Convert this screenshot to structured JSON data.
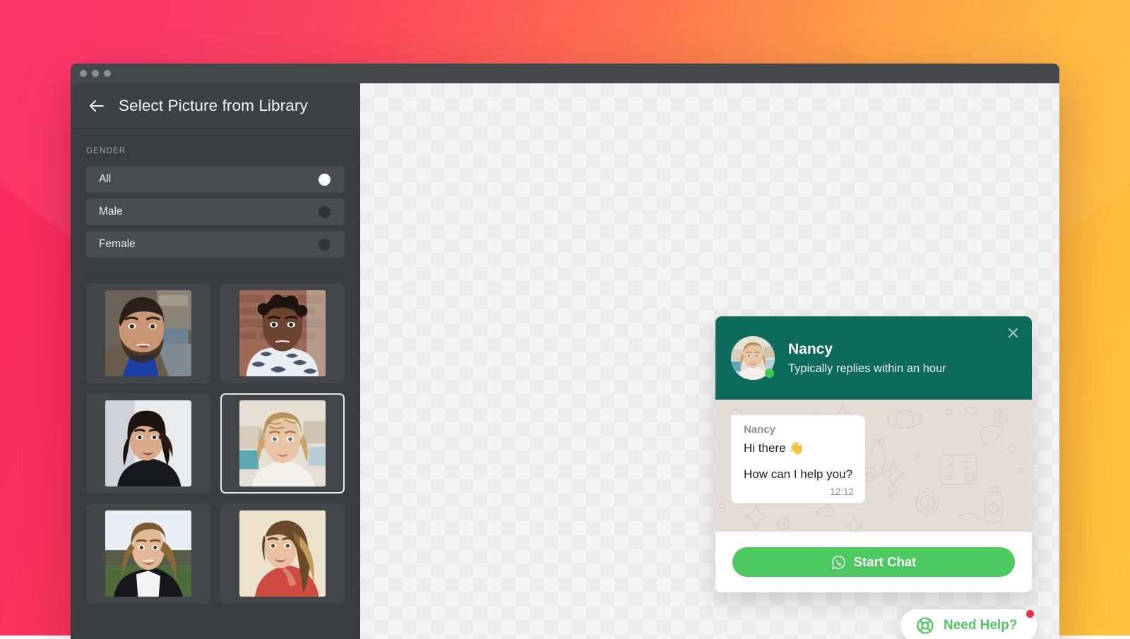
{
  "background": {
    "gradient_start": "#fa2a62",
    "gradient_end": "#fec53c"
  },
  "window": {
    "traffic_lights": [
      "close",
      "minimize",
      "zoom"
    ],
    "sidebar": {
      "back_icon": "arrow-left-icon",
      "title": "Select Picture from Library",
      "filter": {
        "label": "GENDER",
        "options": [
          {
            "label": "All",
            "selected": true
          },
          {
            "label": "Male",
            "selected": false
          },
          {
            "label": "Female",
            "selected": false
          }
        ]
      },
      "thumbnails": [
        {
          "id": "thumb-1",
          "alt": "Man with beard in brown jacket",
          "selected": false
        },
        {
          "id": "thumb-2",
          "alt": "Woman with short curly hair by brick wall",
          "selected": false
        },
        {
          "id": "thumb-3",
          "alt": "Woman with dark wavy hair in black top",
          "selected": false
        },
        {
          "id": "thumb-4",
          "alt": "Woman with blonde braided hair",
          "selected": true
        },
        {
          "id": "thumb-5",
          "alt": "Woman in leather jacket outdoors",
          "selected": false
        },
        {
          "id": "thumb-6",
          "alt": "Woman with long blonde hair in red top",
          "selected": false
        }
      ]
    }
  },
  "chat_widget": {
    "close_icon": "close-icon",
    "agent": {
      "name": "Nancy",
      "status": "Typically replies within an hour",
      "online": true,
      "avatar_icon": "avatar"
    },
    "message": {
      "sender": "Nancy",
      "lines": [
        "Hi there 👋",
        "How can I help you?"
      ],
      "time": "12:12"
    },
    "cta": {
      "label": "Start Chat",
      "icon": "whatsapp-icon",
      "color": "#4dca5f"
    },
    "header_color": "#0c6b5b"
  },
  "need_help": {
    "label": "Need Help?",
    "icon": "lifebuoy-icon",
    "color": "#4dca5f",
    "badge": true,
    "badge_color": "#f42a3c"
  }
}
